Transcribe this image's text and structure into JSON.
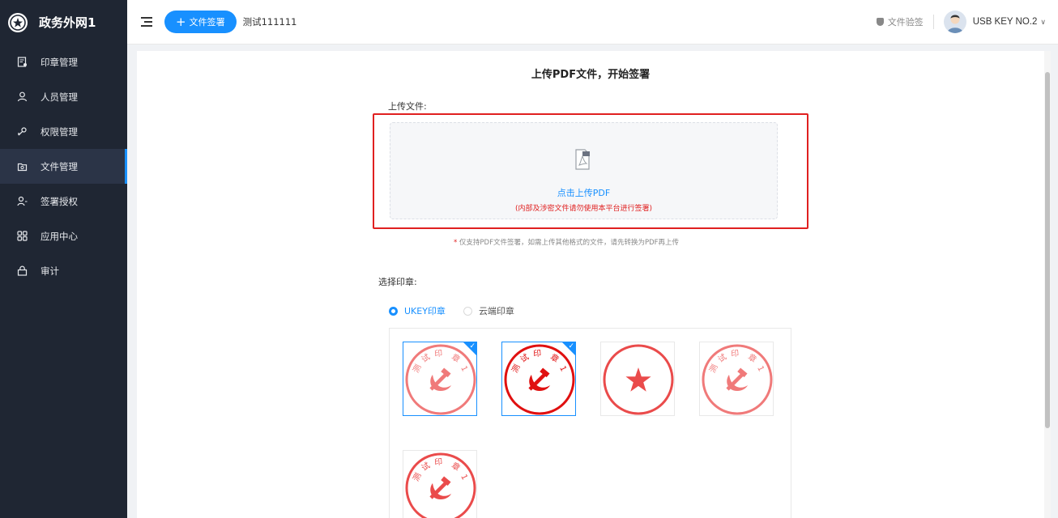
{
  "app": {
    "title": "政务外网1"
  },
  "sidebar": {
    "items": [
      {
        "label": "印章管理",
        "icon": "seal-doc-icon"
      },
      {
        "label": "人员管理",
        "icon": "user-icon"
      },
      {
        "label": "权限管理",
        "icon": "key-icon"
      },
      {
        "label": "文件管理",
        "icon": "folder-icon",
        "active": true
      },
      {
        "label": "签署授权",
        "icon": "authorize-icon"
      },
      {
        "label": "应用中心",
        "icon": "grid-icon"
      },
      {
        "label": "审计",
        "icon": "lock-icon"
      }
    ]
  },
  "header": {
    "sign_button": "文件签署",
    "current_title": "测试111111",
    "verify_label": "文件验签",
    "user_name": "USB KEY NO.2"
  },
  "main": {
    "page_title": "上传PDF文件，开始签署",
    "upload_label": "上传文件:",
    "dropzone_main": "点击上传PDF",
    "dropzone_sub": "(内部及涉密文件请勿使用本平台进行签署)",
    "note_star": "*",
    "note_text": "仅支持PDF文件签署，如需上传其他格式的文件，请先转换为PDF再上传",
    "seal_label": "选择印章:",
    "seal_options": [
      {
        "label": "UKEY印章",
        "checked": true
      },
      {
        "label": "云端印章",
        "checked": false
      }
    ],
    "seals": [
      {
        "name": "seal-1",
        "selected": true,
        "text": "测试印章1",
        "symbol": "hammer-sickle",
        "color": "#f07a7a"
      },
      {
        "name": "seal-2",
        "selected": true,
        "text": "测试印章1",
        "symbol": "hammer-sickle",
        "color": "#e01010"
      },
      {
        "name": "seal-3",
        "selected": false,
        "text": "",
        "symbol": "star",
        "color": "#ea4b4b"
      },
      {
        "name": "seal-4",
        "selected": false,
        "text": "测试印章1",
        "symbol": "hammer-sickle",
        "color": "#f07a7a"
      },
      {
        "name": "seal-5",
        "selected": false,
        "text": "测试印章1",
        "symbol": "hammer-sickle",
        "color": "#ea4b4b"
      }
    ]
  },
  "colors": {
    "accent": "#1890ff",
    "sidebar_bg": "#1f2633",
    "danger": "#e02020"
  }
}
